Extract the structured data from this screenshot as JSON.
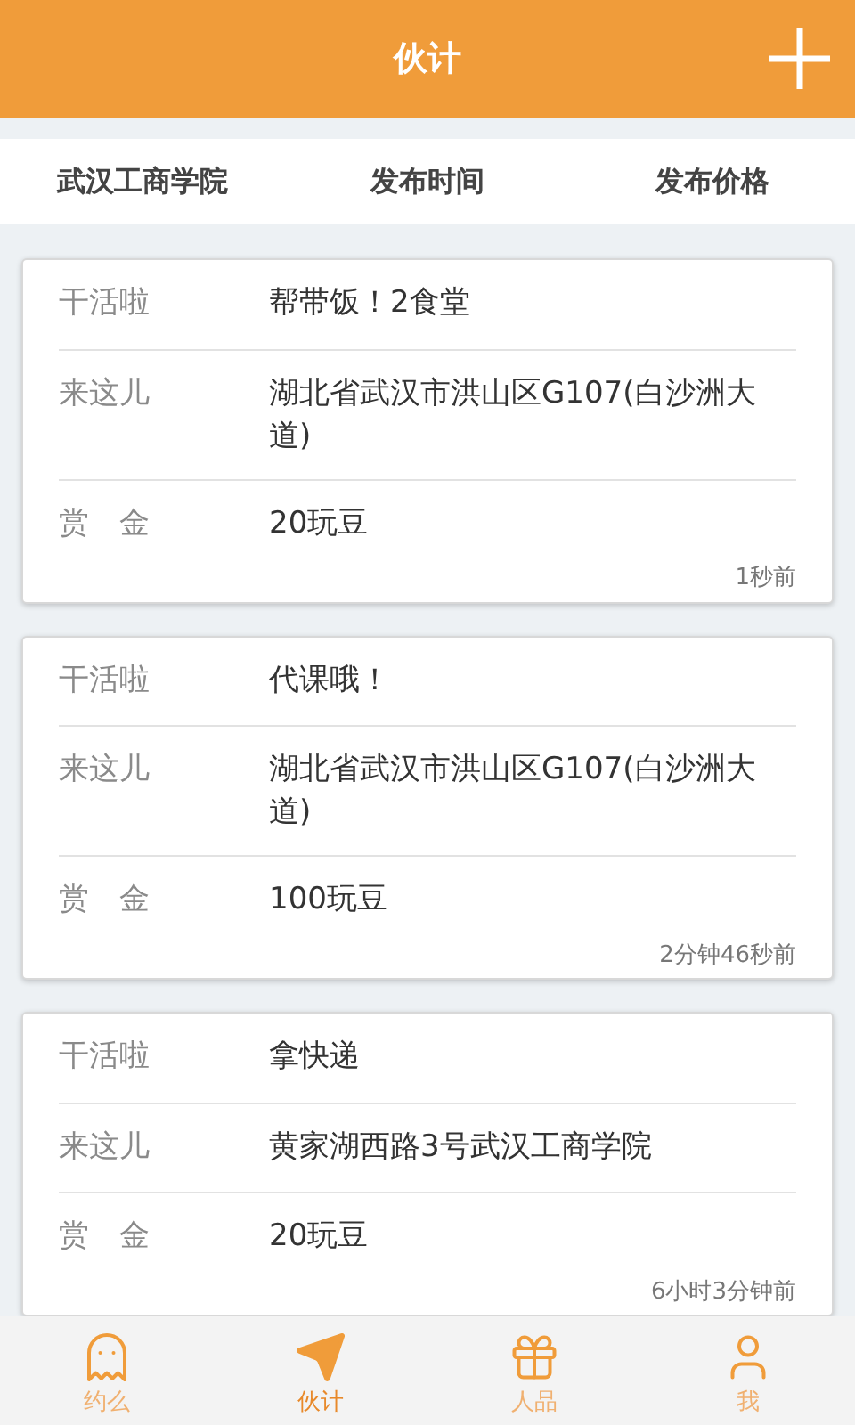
{
  "header": {
    "title": "伙计"
  },
  "filters": [
    {
      "label": "武汉工商学院"
    },
    {
      "label": "发布时间"
    },
    {
      "label": "发布价格"
    }
  ],
  "posts": [
    {
      "rows": [
        {
          "label": "干活啦",
          "value": "帮带饭！2食堂"
        },
        {
          "label": "来这儿",
          "value": "湖北省武汉市洪山区G107(白沙洲大道)"
        },
        {
          "label": "赏　金",
          "value": "20玩豆"
        }
      ],
      "time": "1秒前"
    },
    {
      "rows": [
        {
          "label": "干活啦",
          "value": "代课哦！"
        },
        {
          "label": "来这儿",
          "value": "湖北省武汉市洪山区G107(白沙洲大道)"
        },
        {
          "label": "赏　金",
          "value": "100玩豆"
        }
      ],
      "time": "2分钟46秒前"
    },
    {
      "rows": [
        {
          "label": "干活啦",
          "value": "拿快递"
        },
        {
          "label": "来这儿",
          "value": "黄家湖西路3号武汉工商学院"
        },
        {
          "label": "赏　金",
          "value": "20玩豆"
        }
      ],
      "time": "6小时3分钟前"
    }
  ],
  "tabbar": [
    {
      "kind": "ghost",
      "label": "约么",
      "selected": false
    },
    {
      "kind": "plane",
      "label": "伙计",
      "selected": true
    },
    {
      "kind": "gift",
      "label": "人品",
      "selected": false
    },
    {
      "kind": "person",
      "label": "我",
      "selected": false
    }
  ]
}
